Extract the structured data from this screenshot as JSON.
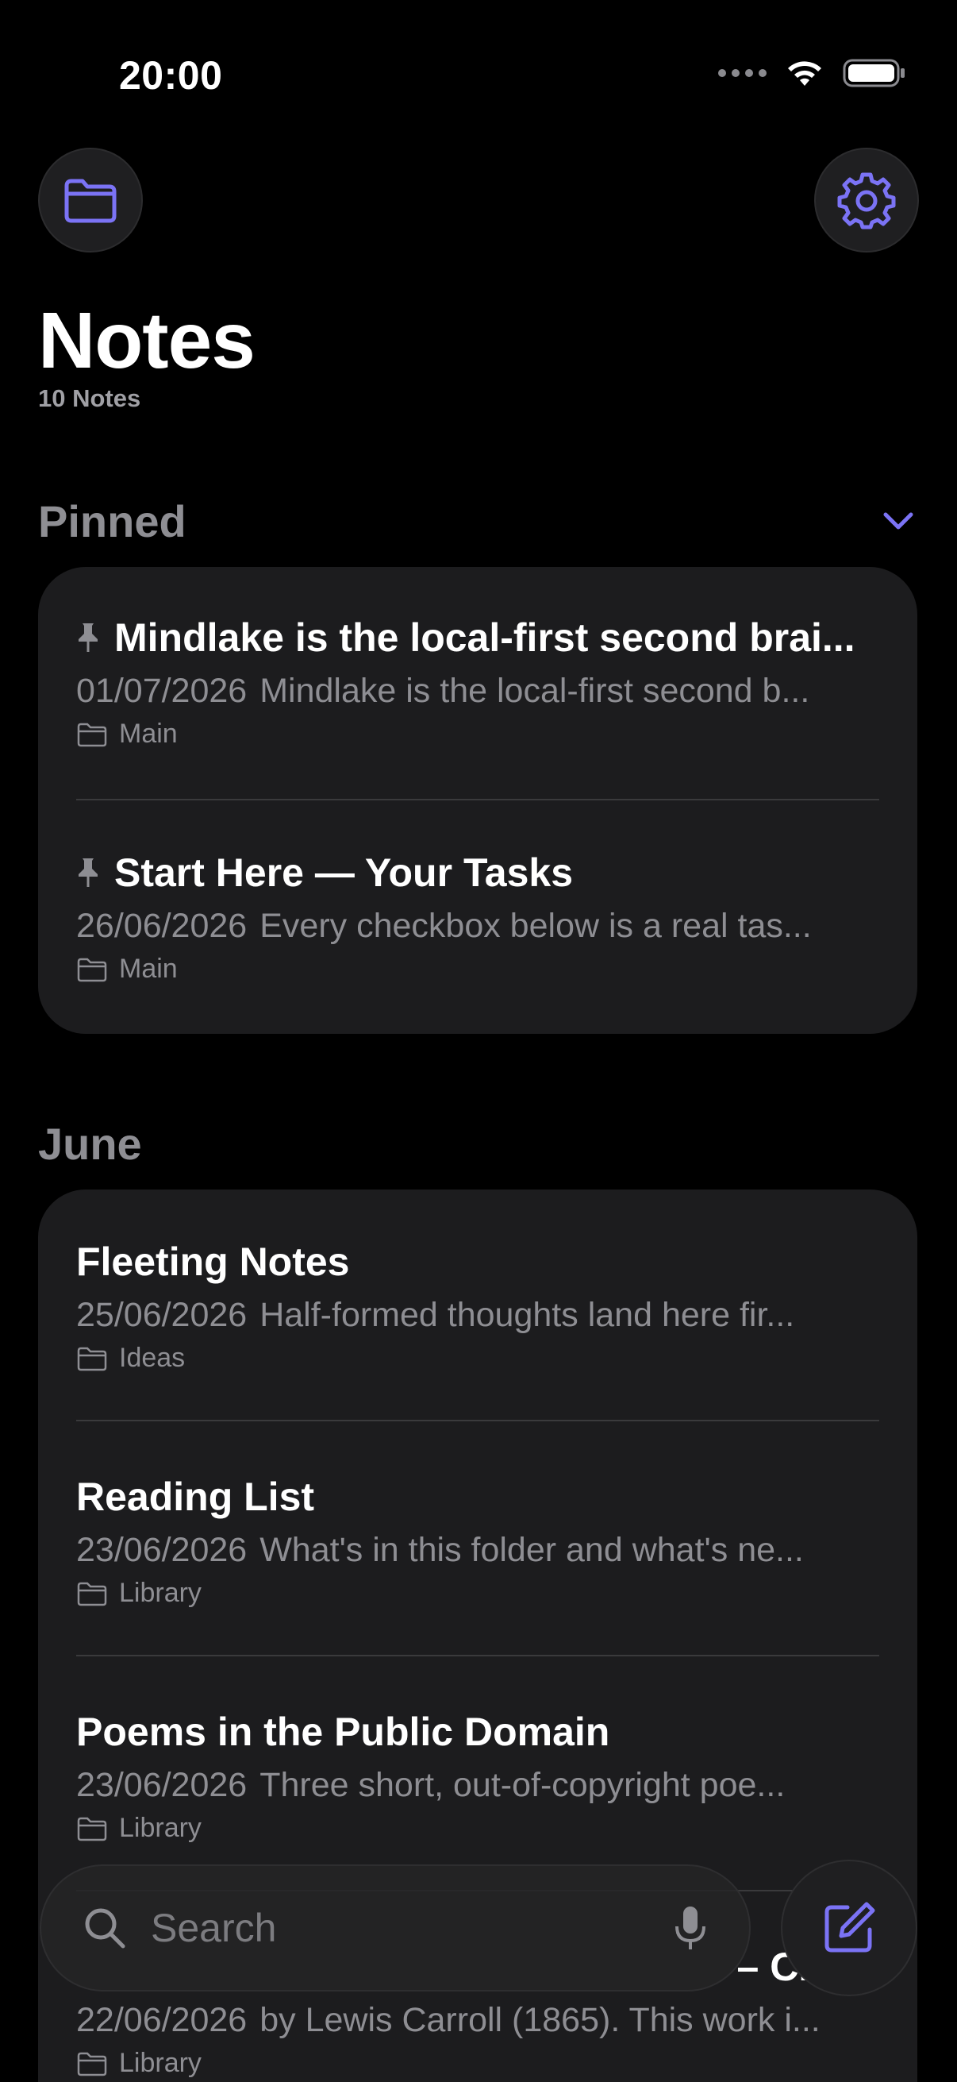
{
  "status": {
    "time": "20:00"
  },
  "header": {
    "title": "Notes",
    "count": "10 Notes"
  },
  "colors": {
    "accent": "#7b73f5",
    "card": "#1c1c1e",
    "muted": "#8e8e93"
  },
  "icons": {
    "folder": "folder-icon",
    "settings": "gear-icon",
    "search": "search-icon",
    "mic": "microphone-icon",
    "compose": "compose-icon",
    "pin": "pin-icon"
  },
  "sections": {
    "pinned": {
      "title": "Pinned",
      "notes": [
        {
          "title": "Mindlake is the local-first second brai...",
          "date": "01/07/2026",
          "preview": "Mindlake is the local-first second b...",
          "folder": "Main"
        },
        {
          "title": "Start Here — Your Tasks",
          "date": "26/06/2026",
          "preview": "Every checkbox below is a real tas...",
          "folder": "Main"
        }
      ]
    },
    "june": {
      "title": "June",
      "notes": [
        {
          "title": "Fleeting Notes",
          "date": "25/06/2026",
          "preview": "Half-formed thoughts land here fir...",
          "folder": "Ideas"
        },
        {
          "title": "Reading List",
          "date": "23/06/2026",
          "preview": "What's in this folder and what's ne...",
          "folder": "Library"
        },
        {
          "title": "Poems in the Public Domain",
          "date": "23/06/2026",
          "preview": "Three short, out-of-copyright poe...",
          "folder": "Library"
        },
        {
          "title": "– C...",
          "date": "22/06/2026",
          "preview": "by Lewis Carroll (1865). This work i...",
          "folder": "Library"
        }
      ]
    }
  },
  "search": {
    "placeholder": "Search"
  }
}
